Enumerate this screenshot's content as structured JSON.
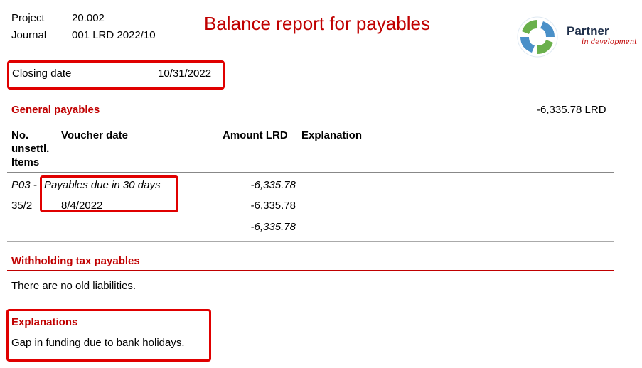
{
  "header": {
    "project_label": "Project",
    "project_value": "20.002",
    "journal_label": "Journal",
    "journal_value": "001 LRD 2022/10",
    "title": "Balance report for payables",
    "logo_word": "Partner",
    "logo_tagline": "in development"
  },
  "closing": {
    "label": "Closing date",
    "value": "10/31/2022"
  },
  "general_payables": {
    "heading": "General payables",
    "total": "-6,335.78 LRD",
    "columns": {
      "no_line1": "No.",
      "no_line2": "unsettl.",
      "no_line3": "Items",
      "voucher_date": "Voucher date",
      "amount": "Amount LRD",
      "explanation": "Explanation"
    },
    "group": {
      "code": "P03 -",
      "name": "Payables due in 30 days",
      "amount": "-6,335.78"
    },
    "row": {
      "number": "35/2",
      "date": "8/4/2022",
      "amount": "-6,335.78"
    },
    "subtotal": "-6,335.78"
  },
  "withholding": {
    "heading": "Withholding tax payables",
    "text": "There are no old liabilities."
  },
  "explanations": {
    "heading": "Explanations",
    "text": "Gap in funding due to bank holidays."
  },
  "colors": {
    "accent": "#c00000",
    "highlight_box": "#e00000",
    "logo_green": "#6ab04c",
    "logo_blue": "#4a90c8"
  }
}
